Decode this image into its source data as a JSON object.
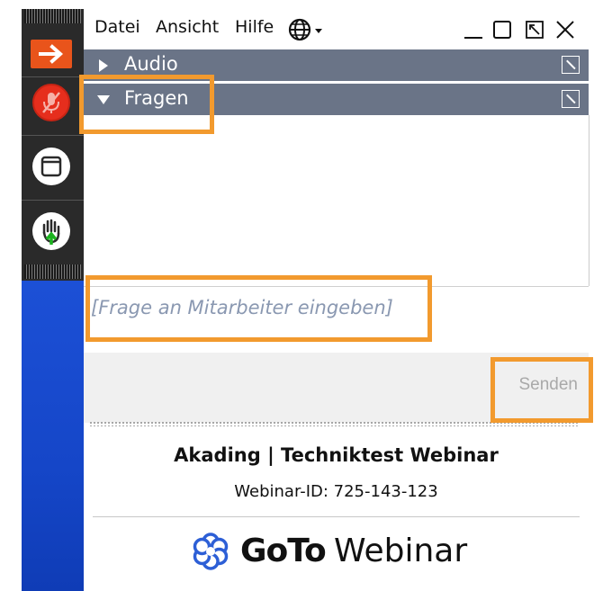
{
  "menubar": {
    "items": [
      "Datei",
      "Ansicht",
      "Hilfe"
    ],
    "globe_icon": "globe-icon"
  },
  "window_controls": [
    "minimize-icon",
    "maximize-icon",
    "popout-icon",
    "close-icon"
  ],
  "panels": {
    "audio": {
      "label": "Audio",
      "collapsed": true
    },
    "questions": {
      "label": "Fragen",
      "collapsed": false
    }
  },
  "question_input": {
    "placeholder": "[Frage an Mitarbeiter eingeben]"
  },
  "send_button": {
    "label": "Senden",
    "enabled": false
  },
  "webinar": {
    "title": "Akading | Techniktest Webinar",
    "id_text": "Webinar-ID: 725-143-123"
  },
  "brand": {
    "logo_bold": "GoTo",
    "logo_light": "Webinar"
  },
  "colors": {
    "panel_bar": "#6a7487",
    "accent_orange": "#e9541b",
    "highlight": "#f29a2e",
    "sidebar_blue": "#1546c8",
    "mic_red": "#e62e1d"
  }
}
